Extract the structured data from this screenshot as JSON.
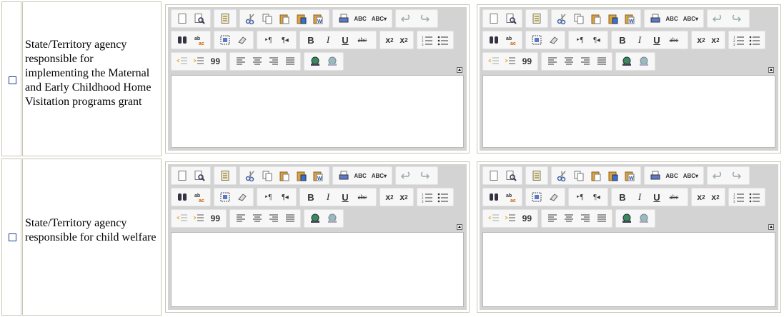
{
  "rows": [
    {
      "label": "State/Territory agency responsible for implementing the Maternal and Early Childhood Home Visitation programs grant"
    },
    {
      "label": "State/Territory agency responsible for child welfare"
    }
  ],
  "toolbar": {
    "subscript_label": "x",
    "subscript_sub": "2",
    "superscript_label": "x",
    "superscript_sup": "2",
    "bold_label": "B",
    "italic_label": "I",
    "underline_label": "U",
    "strike_label": "abc",
    "spell_label": "ABC",
    "quote_label": "99"
  },
  "colors": {
    "toolbar_bg": "#d3d3d3",
    "button_group_bg": "#f7f7f7",
    "grid_border": "#c9c7b6",
    "checkbox_border": "#1c3f95"
  }
}
